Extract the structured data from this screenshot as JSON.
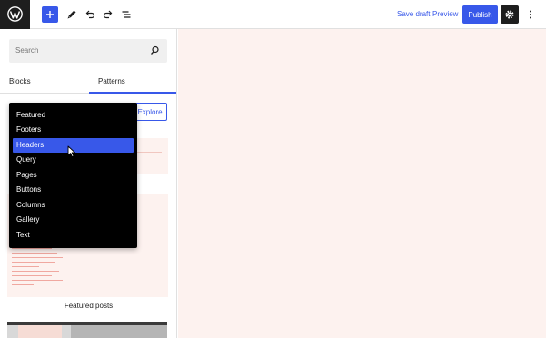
{
  "toolbar": {
    "logo_icon": "wordpress-logo-icon",
    "add_icon": "plus-icon",
    "tools_icon": "pen-icon",
    "undo_icon": "undo-icon",
    "redo_icon": "redo-icon",
    "list_view_icon": "list-view-icon",
    "save_draft_label": "Save draft",
    "preview_label": "Preview",
    "publish_label": "Publish",
    "settings_icon": "gear-icon",
    "more_icon": "more-vertical-icon",
    "accent_color": "#3858e9"
  },
  "inserter": {
    "search_placeholder": "Search",
    "search_icon": "search-icon",
    "tabs": [
      {
        "label": "Blocks",
        "active": false
      },
      {
        "label": "Patterns",
        "active": true
      }
    ],
    "explore_label": "Explore",
    "pattern_label": "Featured posts"
  },
  "dropdown": {
    "items": [
      {
        "label": "Featured"
      },
      {
        "label": "Footers"
      },
      {
        "label": "Headers",
        "selected": true
      },
      {
        "label": "Query"
      },
      {
        "label": "Pages"
      },
      {
        "label": "Buttons"
      },
      {
        "label": "Columns"
      },
      {
        "label": "Gallery"
      },
      {
        "label": "Text"
      }
    ]
  },
  "canvas": {
    "background_color": "#fdf2ef"
  }
}
